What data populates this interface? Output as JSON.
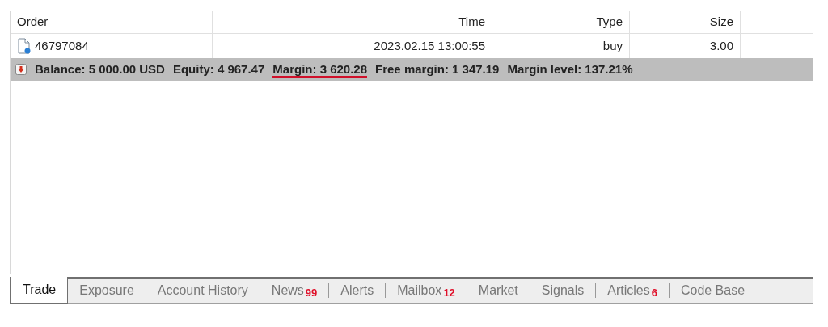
{
  "table": {
    "columns": [
      "Order",
      "Time",
      "Type",
      "Size"
    ],
    "rows": [
      {
        "cells": [
          "46797084",
          "2023.02.15 13:00:55",
          "buy",
          "3.00"
        ]
      }
    ],
    "summary": [
      {
        "text": "Balance: 5 000.00 USD",
        "underlined": false
      },
      {
        "text": "Equity: 4 967.47",
        "underlined": false
      },
      {
        "text": "Margin: 3 620.28",
        "underlined": true
      },
      {
        "text": "Free margin: 1 347.19",
        "underlined": false
      },
      {
        "text": "Margin level: 137.21%",
        "underlined": false
      }
    ]
  },
  "tabs": [
    {
      "label": "Trade",
      "selected": true
    },
    {
      "label": "Exposure",
      "selected": false
    },
    {
      "label": "Account History",
      "selected": false
    },
    {
      "label": "News",
      "badge": "99",
      "selected": false
    },
    {
      "label": "Alerts",
      "selected": false
    },
    {
      "label": "Mailbox",
      "badge": "12",
      "selected": false
    },
    {
      "label": "Market",
      "selected": false
    },
    {
      "label": "Signals",
      "selected": false
    },
    {
      "label": "Articles",
      "badge": "6",
      "selected": false
    },
    {
      "label": "Code Base",
      "selected": false
    }
  ]
}
